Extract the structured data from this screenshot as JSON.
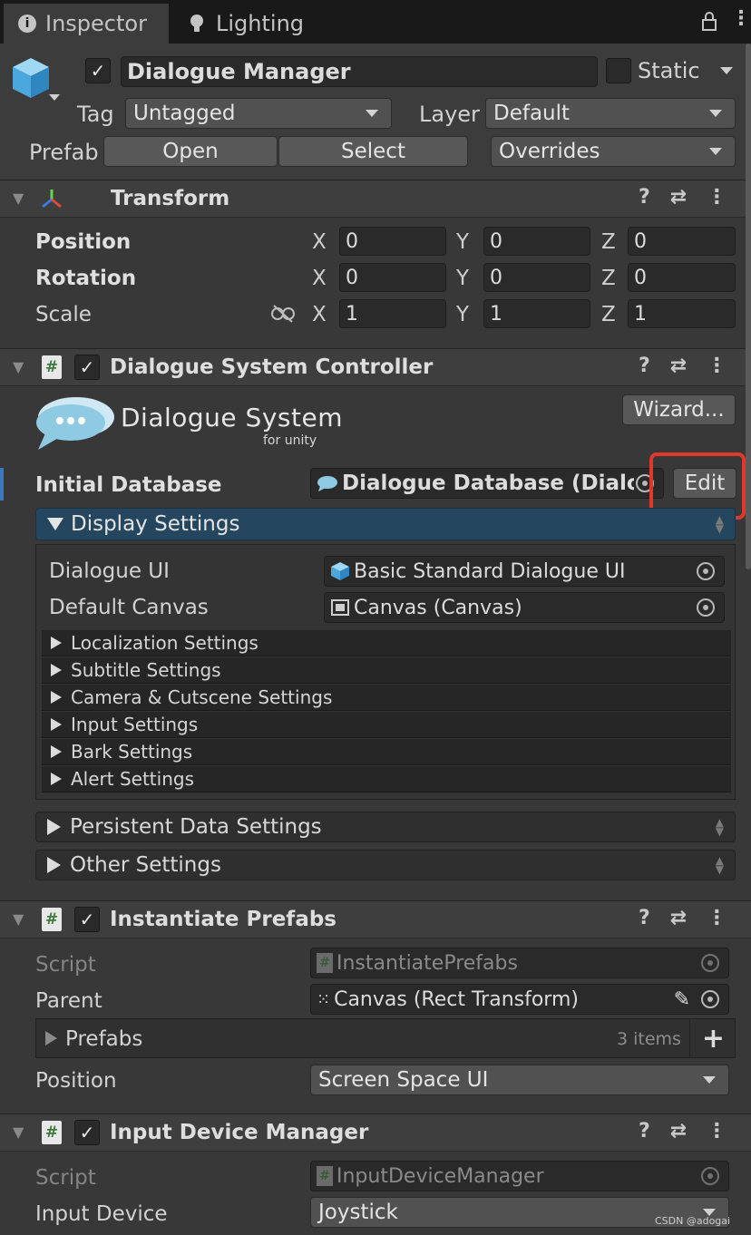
{
  "tabs": [
    {
      "label": "Inspector",
      "icon": "info-icon"
    },
    {
      "label": "Lighting",
      "icon": "lightbulb-icon"
    }
  ],
  "gameobject": {
    "name": "Dialogue Manager",
    "active": true,
    "static_label": "Static",
    "tag_label": "Tag",
    "tag_value": "Untagged",
    "layer_label": "Layer",
    "layer_value": "Default",
    "prefab_label": "Prefab",
    "open_label": "Open",
    "select_label": "Select",
    "overrides_label": "Overrides"
  },
  "transform": {
    "title": "Transform",
    "rows": [
      {
        "label": "Position",
        "x": "0",
        "y": "0",
        "z": "0"
      },
      {
        "label": "Rotation",
        "x": "0",
        "y": "0",
        "z": "0"
      },
      {
        "label": "Scale",
        "x": "1",
        "y": "1",
        "z": "1"
      }
    ],
    "axis": {
      "x": "X",
      "y": "Y",
      "z": "Z"
    }
  },
  "dsc": {
    "title": "Dialogue System Controller",
    "logo_title": "Dialogue System",
    "logo_sub": "for unity",
    "wizard_label": "Wizard...",
    "initial_db_label": "Initial Database",
    "initial_db_value": "Dialogue Database (Dialogu",
    "edit_label": "Edit",
    "display_settings_label": "Display Settings",
    "dialogue_ui_label": "Dialogue UI",
    "dialogue_ui_value": "Basic Standard Dialogue UI",
    "default_canvas_label": "Default Canvas",
    "default_canvas_value": "Canvas (Canvas)",
    "subsections": [
      "Localization Settings",
      "Subtitle Settings",
      "Camera & Cutscene Settings",
      "Input Settings",
      "Bark Settings",
      "Alert Settings"
    ],
    "persistent_label": "Persistent Data Settings",
    "other_label": "Other Settings"
  },
  "instantiate": {
    "title": "Instantiate Prefabs",
    "script_label": "Script",
    "script_value": "InstantiatePrefabs",
    "parent_label": "Parent",
    "parent_value": "Canvas (Rect Transform)",
    "prefabs_label": "Prefabs",
    "prefabs_count": "3 items",
    "position_label": "Position",
    "position_value": "Screen Space UI"
  },
  "input_device": {
    "title": "Input Device Manager",
    "script_label": "Script",
    "script_value": "InputDeviceManager",
    "device_label": "Input Device",
    "device_value": "Joystick"
  },
  "watermark": "CSDN @adogai",
  "colors": {
    "highlight": "#e2372d",
    "display_header": "#24465e",
    "accent_blue": "#3a79bb"
  }
}
